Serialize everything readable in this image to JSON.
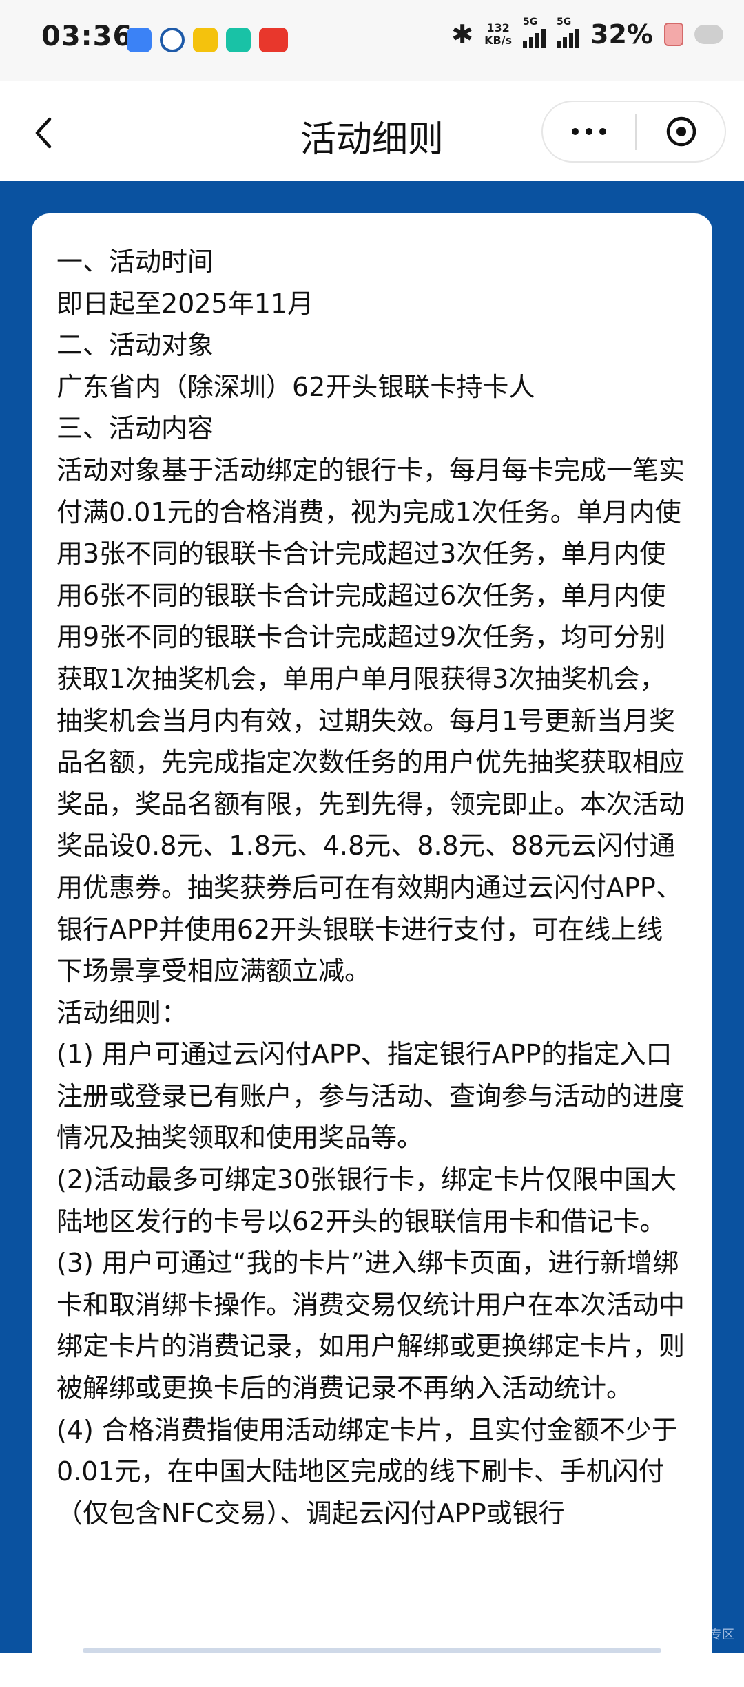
{
  "status_bar": {
    "time": "03:36",
    "net_speed_value": "132",
    "net_speed_unit": "KB/s",
    "signal1_label": "5G",
    "signal2_label": "5G",
    "battery": "32%",
    "icons": [
      "app-icon-blue",
      "app-icon-swirl",
      "app-icon-yellow",
      "app-icon-green",
      "app-icon-red",
      "bluetooth-icon",
      "battery-icon",
      "cloud-icon"
    ]
  },
  "nav": {
    "title": "活动细则"
  },
  "rules": [
    "一、活动时间",
    "即日起至2025年11月",
    "二、活动对象",
    "广东省内（除深圳）62开头银联卡持卡人",
    "三、活动内容",
    "活动对象基于活动绑定的银行卡，每月每卡完成一笔实付满0.01元的合格消费，视为完成1次任务。单月内使用3张不同的银联卡合计完成超过3次任务，单月内使用6张不同的银联卡合计完成超过6次任务，单月内使用9张不同的银联卡合计完成超过9次任务，均可分别获取1次抽奖机会，单用户单月限获得3次抽奖机会，抽奖机会当月内有效，过期失效。每月1号更新当月奖品名额，先完成指定次数任务的用户优先抽奖获取相应奖品，奖品名额有限，先到先得，领完即止。本次活动奖品设0.8元、1.8元、4.8元、8.8元、88元云闪付通用优惠券。抽奖获券后可在有效期内通过云闪付APP、银行APP并使用62开头银联卡进行支付，可在线上线下场景享受相应满额立减。",
    "活动细则：",
    "(1) 用户可通过云闪付APP、指定银行APP的指定入口注册或登录已有账户，参与活动、查询参与活动的进度情况及抽奖领取和使用奖品等。",
    "(2)活动最多可绑定30张银行卡，绑定卡片仅限中国大陆地区发行的卡号以62开头的银联信用卡和借记卡。",
    "(3) 用户可通过“我的卡片”进入绑卡页面，进行新增绑卡和取消绑卡操作。消费交易仅统计用户在本次活动中绑定卡片的消费记录，如用户解绑或更换绑定卡片，则被解绑或更换卡后的消费记录不再纳入活动统计。",
    "(4) 合格消费指使用活动绑定卡片，且实付金额不少于0.01元，在中国大陆地区完成的线下刷卡、手机闪付（仅包含NFC交易）、调起云闪付APP或银行"
  ],
  "watermark": "专区"
}
